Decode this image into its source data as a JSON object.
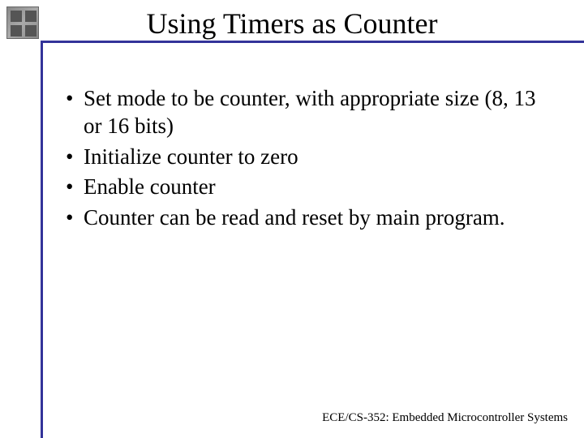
{
  "slide": {
    "title": "Using Timers as Counter",
    "bullets": [
      "Set mode to be counter, with appropriate size (8, 13 or 16 bits)",
      "Initialize counter to zero",
      "Enable counter",
      "Counter can be read and reset by main program."
    ],
    "footer": "ECE/CS-352: Embedded Microcontroller Systems"
  }
}
